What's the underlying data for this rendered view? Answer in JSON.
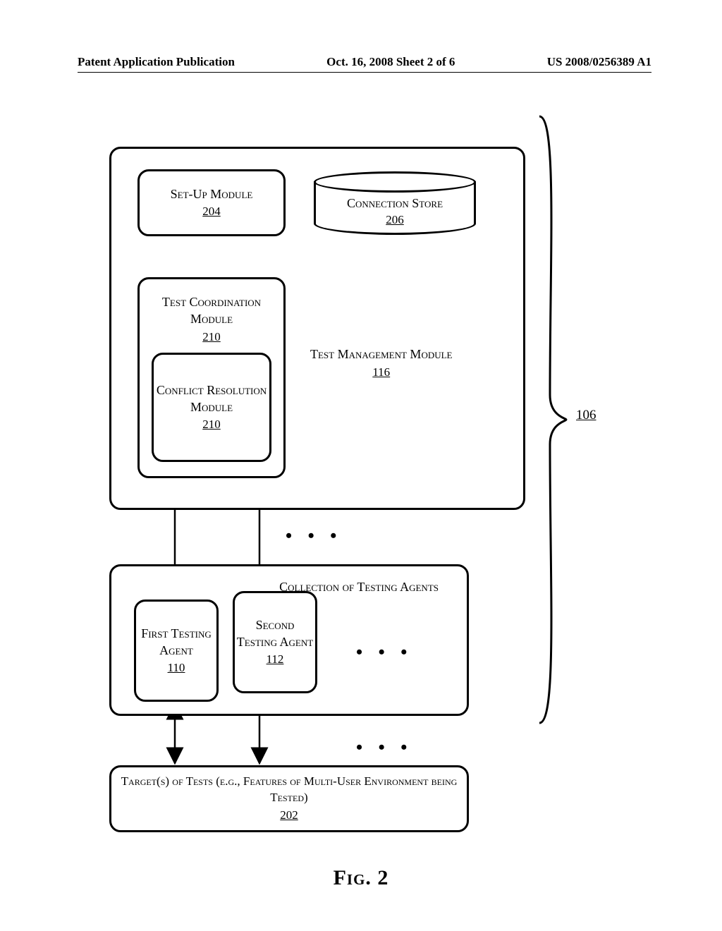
{
  "header": {
    "left": "Patent Application Publication",
    "center": "Oct. 16, 2008  Sheet 2 of 6",
    "right": "US 2008/0256389 A1"
  },
  "diagram": {
    "setup": {
      "title": "Set-Up Module",
      "ref": "204"
    },
    "store": {
      "title": "Connection Store",
      "ref": "206"
    },
    "coord": {
      "title": "Test Coordination Module",
      "ref": "210"
    },
    "conflict": {
      "title": "Conflict Resolution Module",
      "ref": "210"
    },
    "mgmt": {
      "title": "Test Management Module",
      "ref": "116"
    },
    "agents_group": {
      "title": "Collection of Testing Agents"
    },
    "agent1": {
      "title": "First Testing Agent",
      "ref": "110"
    },
    "agent2": {
      "title": "Second Testing Agent",
      "ref": "112"
    },
    "targets": {
      "title": "Target(s) of Tests (e.g., Features of Multi-User Environment being Tested)",
      "ref": "202"
    },
    "system_ref": "106",
    "figure_label": "Fig. 2"
  }
}
